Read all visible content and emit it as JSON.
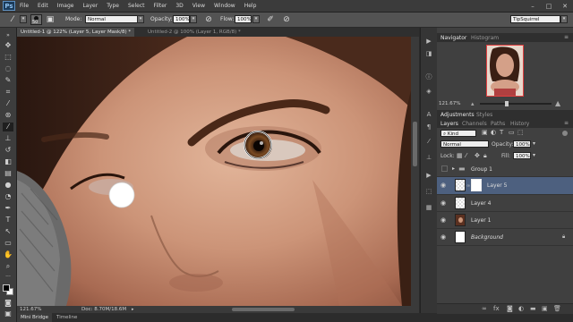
{
  "menubar": {
    "logo": "Ps",
    "items": [
      "File",
      "Edit",
      "Image",
      "Layer",
      "Type",
      "Select",
      "Filter",
      "3D",
      "View",
      "Window",
      "Help"
    ]
  },
  "options": {
    "brush_size": "50",
    "mode_label": "Mode:",
    "mode_value": "Normal",
    "opacity_label": "Opacity:",
    "opacity_value": "100%",
    "flow_label": "Flow:",
    "flow_value": "100%",
    "workspace": "TipSquirrel"
  },
  "documents": {
    "tabs": [
      {
        "label": "Untitled-1 @ 122% (Layer 5, Layer Mask/8) *",
        "active": true
      },
      {
        "label": "Untitled-2 @ 100% (Layer 1, RGB/8) *",
        "active": false
      }
    ]
  },
  "status": {
    "zoom": "121.67%",
    "doc": "Doc: 8.70M/18.6M"
  },
  "bottom_tabs": [
    "Mini Bridge",
    "Timeline"
  ],
  "navigator": {
    "tabs": [
      "Navigator",
      "Histogram"
    ],
    "zoom": "121.67%"
  },
  "adjustments": {
    "tabs": [
      "Adjustments",
      "Styles"
    ]
  },
  "layers_panel": {
    "tabs": [
      "Layers",
      "Channels",
      "Paths",
      "History"
    ],
    "kind_label": "Kind",
    "blend_mode": "Normal",
    "opacity_label": "Opacity:",
    "opacity_value": "100%",
    "lock_label": "Lock:",
    "fill_label": "Fill:",
    "fill_value": "100%",
    "layers": [
      {
        "name": "Group 1",
        "type": "group"
      },
      {
        "name": "Layer 5",
        "type": "mask",
        "selected": true
      },
      {
        "name": "Layer 4",
        "type": "layer"
      },
      {
        "name": "Layer 1",
        "type": "photo"
      },
      {
        "name": "Background",
        "type": "background",
        "locked": true
      }
    ]
  },
  "colors": {
    "accent_selected": "#4d607f",
    "ui_dark": "#2b2b2b",
    "logo_blue": "#8fc1ee"
  }
}
